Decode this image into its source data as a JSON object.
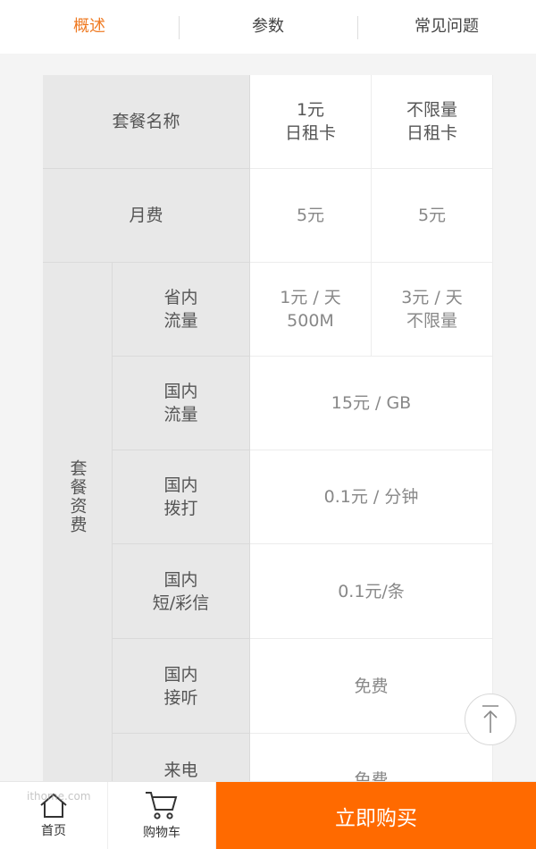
{
  "tabs": [
    {
      "label": "概述",
      "active": true
    },
    {
      "label": "参数",
      "active": false
    },
    {
      "label": "常见问题",
      "active": false
    }
  ],
  "table": {
    "plan_name_label": "套餐名称",
    "plan_a_name": "1元\n日租卡",
    "plan_b_name": "不限量\n日租卡",
    "monthly_fee_label": "月费",
    "plan_a_fee": "5元",
    "plan_b_fee": "5元",
    "group_label": "套餐资费",
    "rows": [
      {
        "label": "省内\n流量",
        "plan_a": "1元 / 天\n500M",
        "plan_b": "3元 / 天\n不限量"
      },
      {
        "label": "国内\n流量",
        "value": "15元 / GB"
      },
      {
        "label": "国内\n拨打",
        "value": "0.1元 / 分钟"
      },
      {
        "label": "国内\n短/彩信",
        "value": "0.1元/条"
      },
      {
        "label": "国内\n接听",
        "value": "免费"
      },
      {
        "label": "来电\n显示",
        "value": "免费"
      }
    ]
  },
  "bottom_bar": {
    "home_label": "首页",
    "cart_label": "购物车",
    "buy_label": "立即购买"
  },
  "watermark": "ithome.com",
  "colors": {
    "accent_tab": "#ef7a22",
    "buy_button": "#ff6a00",
    "header_cell": "#e8e8e8"
  },
  "icons": [
    "arrow-up-icon",
    "home-icon",
    "cart-icon"
  ]
}
